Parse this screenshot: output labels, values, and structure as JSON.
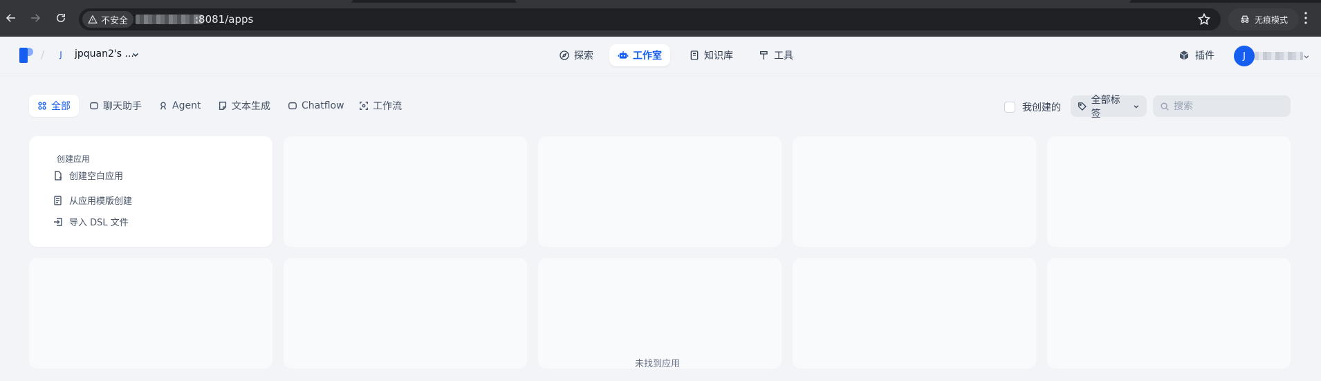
{
  "browser": {
    "security_label": "不安全",
    "url": ":8081/apps",
    "incognito_label": "无痕模式"
  },
  "header": {
    "workspace_initial": "J",
    "workspace_name": "jpquan2's ...",
    "nav": [
      {
        "label": "探索",
        "icon": "explore-icon",
        "active": false
      },
      {
        "label": "工作室",
        "icon": "robot-icon",
        "active": true
      },
      {
        "label": "知识库",
        "icon": "book-icon",
        "active": false
      },
      {
        "label": "工具",
        "icon": "hammer-icon",
        "active": false
      }
    ],
    "plugin_label": "插件",
    "user_initial": "J"
  },
  "filters": {
    "tabs": [
      {
        "label": "全部",
        "icon": "grid-icon",
        "active": true
      },
      {
        "label": "聊天助手",
        "icon": "chat-icon",
        "active": false
      },
      {
        "label": "Agent",
        "icon": "agent-icon",
        "active": false
      },
      {
        "label": "文本生成",
        "icon": "note-icon",
        "active": false
      },
      {
        "label": "Chatflow",
        "icon": "chatflow-icon",
        "active": false
      },
      {
        "label": "工作流",
        "icon": "workflow-icon",
        "active": false
      }
    ],
    "created_by_me_label": "我创建的",
    "created_by_me_checked": false,
    "tag_select_label": "全部标签",
    "search_placeholder": "搜索"
  },
  "create_card": {
    "title": "创建应用",
    "items": [
      {
        "label": "创建空白应用",
        "icon": "blank-file-icon"
      },
      {
        "label": "从应用模版创建",
        "icon": "template-icon"
      },
      {
        "label": "导入 DSL 文件",
        "icon": "import-icon"
      }
    ]
  },
  "empty_state": "未找到应用",
  "colors": {
    "accent": "#155eef",
    "page_bg": "#f2f4f7",
    "card_placeholder": "#f9fafb"
  }
}
